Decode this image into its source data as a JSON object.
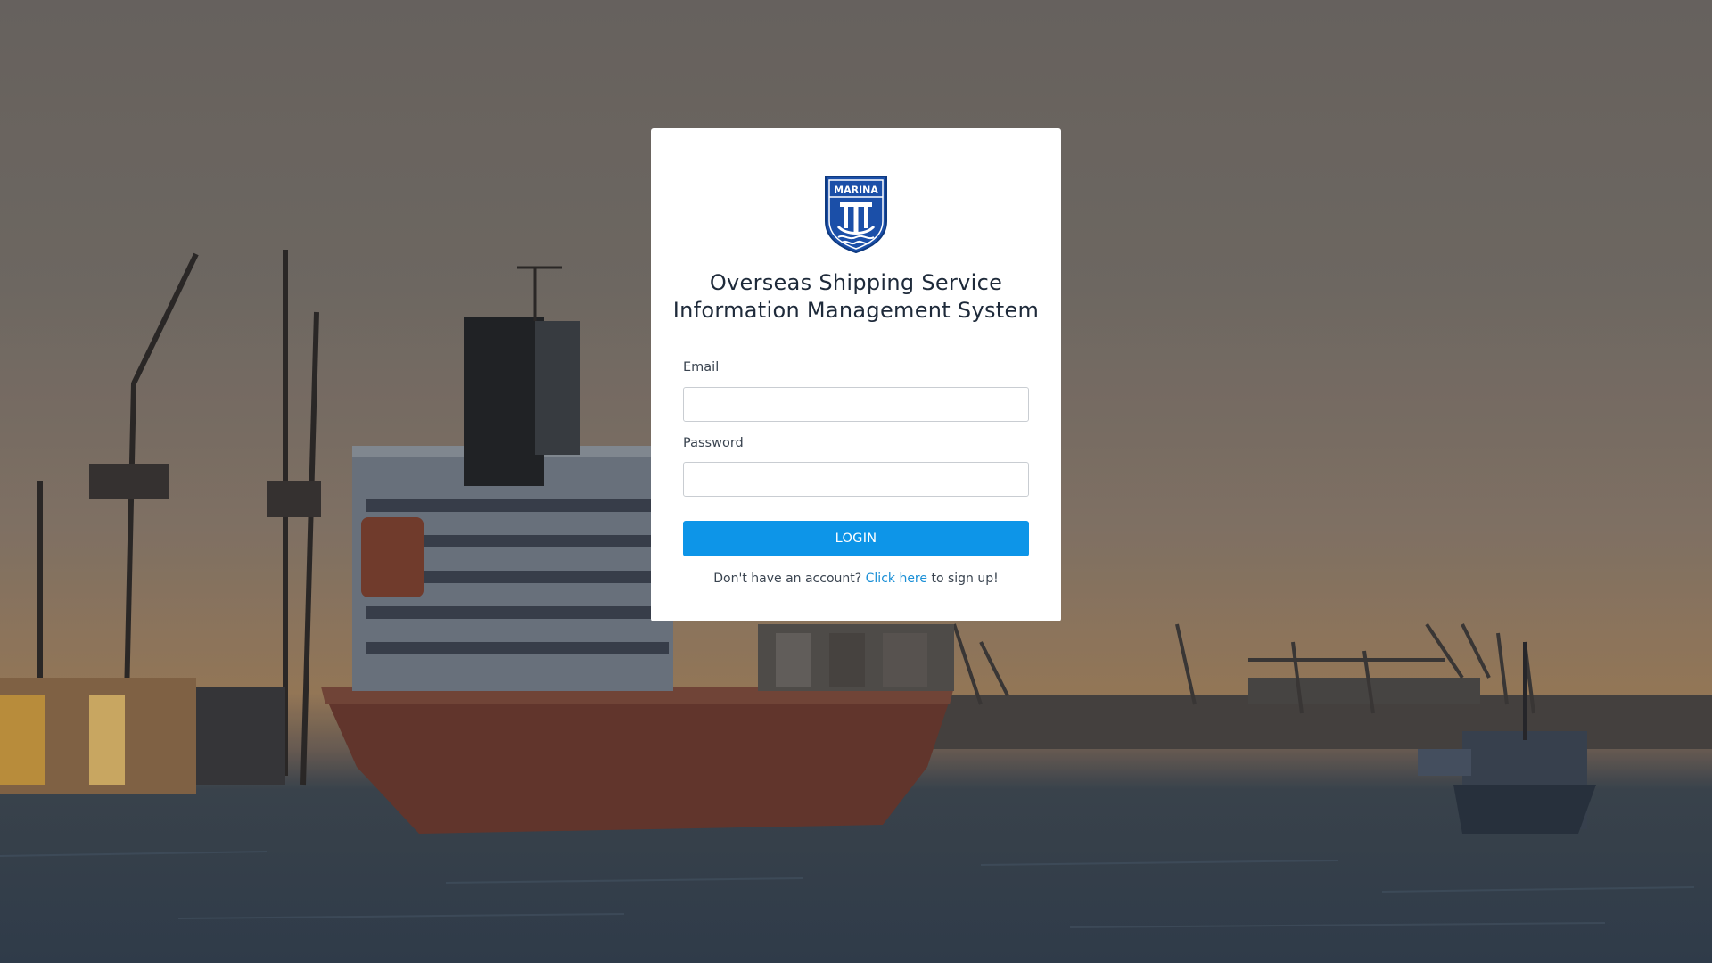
{
  "background": {
    "description_icon": "harbor-background"
  },
  "brand": {
    "logo_text": "MARINA",
    "logo_color": "#1b4fa8",
    "title_line1": "Overseas Shipping Service",
    "title_line2": "Information Management System"
  },
  "form": {
    "email_label": "Email",
    "email_value": "",
    "password_label": "Password",
    "password_value": "",
    "login_label": "LOGIN",
    "accent_color": "#0d95e8"
  },
  "signup": {
    "prefix": "Don't have an account?",
    "link_text": "Click here",
    "suffix": "to sign up!"
  }
}
